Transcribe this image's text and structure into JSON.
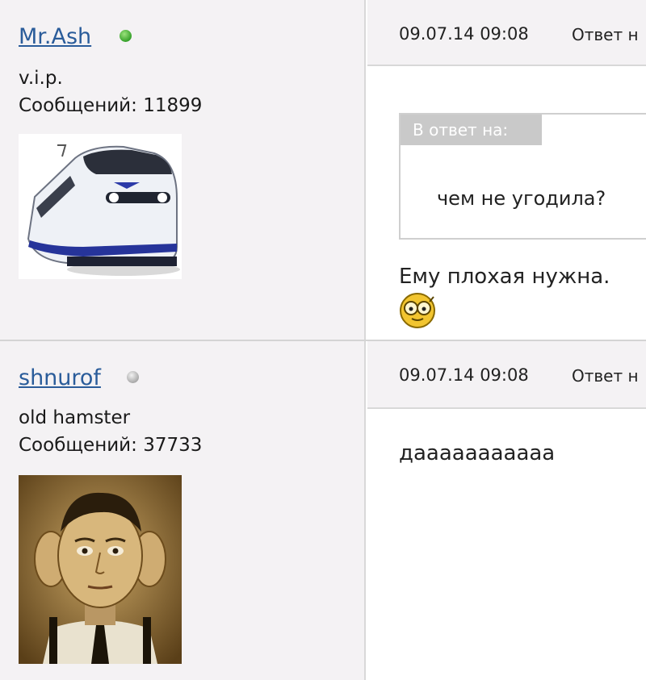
{
  "posts": [
    {
      "author": "Mr.Ash",
      "online": true,
      "rank": "v.i.p.",
      "messages_label": "Сообщений: 11899",
      "avatar_icon": "train-avatar",
      "date": "09.07.14 09:08",
      "reply_label": "Ответ н",
      "quote": {
        "header": "В ответ на:",
        "text": "чем не угодила?"
      },
      "body": "Ему плохая нужна.",
      "emoticon": "smiley-glasses-icon"
    },
    {
      "author": "shnurof",
      "online": false,
      "rank": "old hamster",
      "messages_label": "Сообщений: 37733",
      "avatar_icon": "big-ears-man-avatar",
      "date": "09.07.14 09:08",
      "reply_label": "Ответ н",
      "body": "дааааааааааа"
    }
  ]
}
